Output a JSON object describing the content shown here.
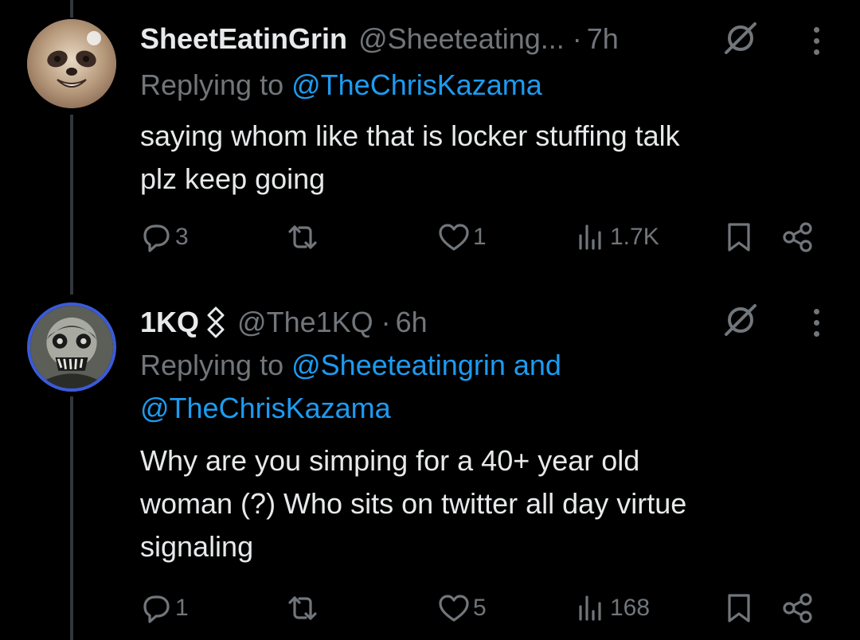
{
  "tweets": [
    {
      "display_name": "SheetEatinGrin",
      "handle": "@Sheeteating...",
      "dot": "·",
      "time": "7h",
      "replying_prefix": "Replying to",
      "replying_mentions": [
        "@TheChrisKazama"
      ],
      "replying_joiner": "",
      "body_lines": [
        "saying whom like that is locker stuffing talk",
        "plz keep going"
      ],
      "replies": "3",
      "reposts": "",
      "likes": "1",
      "views": "1.7K"
    },
    {
      "display_name": "1KQ",
      "handle": "@The1KQ",
      "dot": "·",
      "time": "6h",
      "replying_prefix": "Replying to",
      "replying_mentions": [
        "@Sheeteatingrin",
        "@TheChrisKazama"
      ],
      "replying_joiner": "and",
      "body_lines": [
        "Why are you simping for a 40+ year old",
        "woman (?) Who sits on twitter all day virtue",
        "signaling"
      ],
      "replies": "1",
      "reposts": "",
      "likes": "5",
      "views": "168"
    }
  ],
  "colors": {
    "background": "#000000",
    "text": "#e7e9ea",
    "muted": "#71767b",
    "link": "#1d9bf0",
    "thread_line": "#333639",
    "avatar_ring": "#3a5bd9"
  },
  "icons": {
    "reply": "reply-icon",
    "repost": "repost-icon",
    "like": "heart-icon",
    "views": "views-icon",
    "bookmark": "bookmark-icon",
    "share": "share-icon",
    "grok": "grok-icon",
    "more": "more-icon",
    "links": "links-icon"
  }
}
